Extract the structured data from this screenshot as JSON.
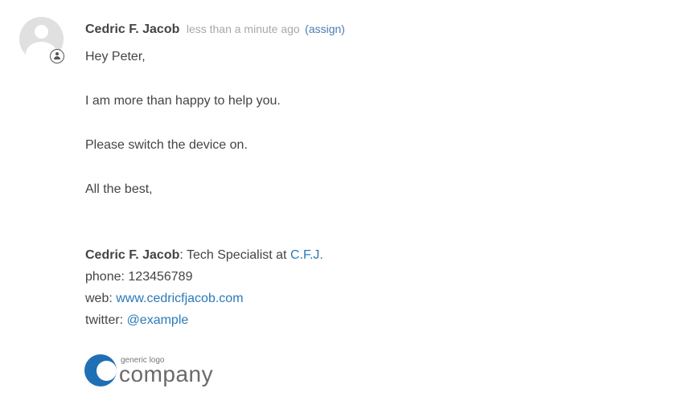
{
  "message": {
    "author": "Cedric F. Jacob",
    "timestamp": "less than a minute ago",
    "assign_label": "(assign)",
    "avatar_icon": "user-avatar-icon",
    "badge_icon": "user-circle-icon",
    "body": {
      "greeting": "Hey Peter,",
      "line1": "I am more than happy to help you.",
      "line2": "Please switch the device on.",
      "closing": "All the best,"
    },
    "signature": {
      "name": "Cedric F. Jacob",
      "title": ": Tech Specialist at ",
      "company_link": "C.F.J.",
      "phone_label": "phone: ",
      "phone": "123456789",
      "web_label": "web: ",
      "web": "www.cedricfjacob.com",
      "twitter_label": "twitter: ",
      "twitter": "@example"
    },
    "logo": {
      "small_text": "generic logo",
      "big_text": "company"
    }
  },
  "colors": {
    "text": "#444444",
    "muted": "#a8a8a8",
    "link": "#2a7ab8",
    "assign_link": "#4a7cb0",
    "logo_blue": "#1f6fb5",
    "avatar_bg": "#e0e0e0"
  }
}
